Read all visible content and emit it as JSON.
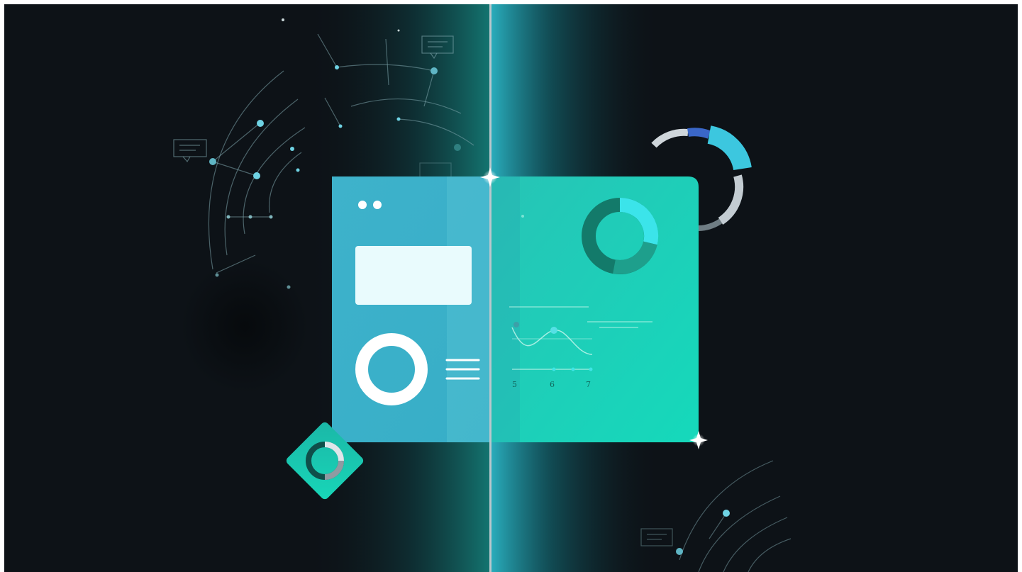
{
  "illustration": {
    "colors": {
      "background": "#0d1217",
      "panel_left": "#3fb3cc",
      "panel_right": "#1ed1b7",
      "accent_cyan": "#3be4ea",
      "accent_blue": "#3a67c8",
      "dark_teal": "#137a6a"
    },
    "axis_ticks": [
      "5",
      "6",
      "7"
    ]
  }
}
